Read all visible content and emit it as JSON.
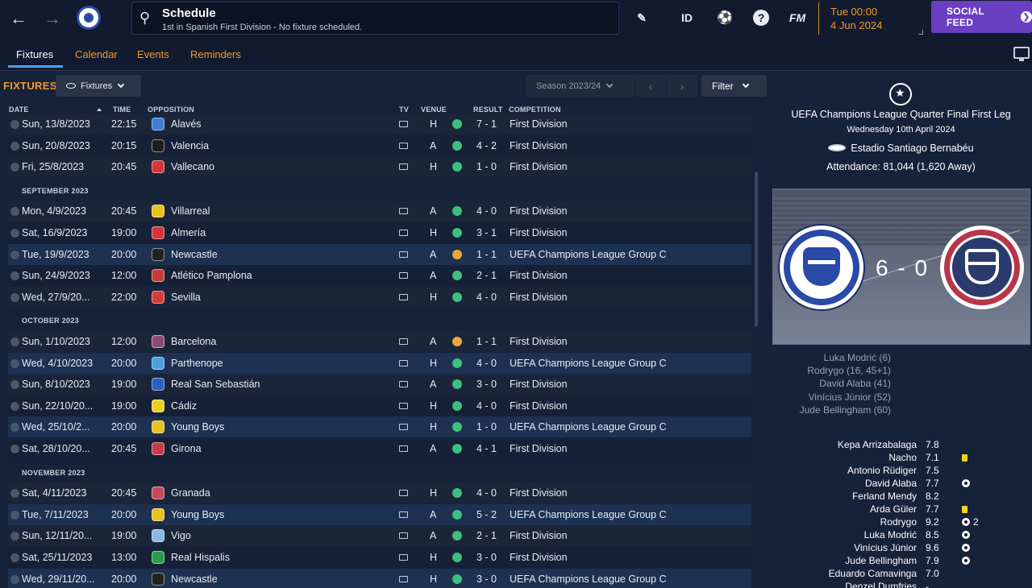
{
  "header": {
    "search_title": "Schedule",
    "search_subtitle": "1st in Spanish First Division - No fixture scheduled.",
    "id_label": "ID",
    "fm_label": "FM",
    "help_label": "?",
    "time": "Tue 00:00",
    "date": "4 Jun 2024",
    "social_feed_label": "SOCIAL FEED",
    "icons": {
      "back": "arrow-left-icon",
      "forward": "arrow-right-icon",
      "search": "search-icon",
      "edit": "pencil-icon",
      "football": "football-icon",
      "help": "help-icon"
    }
  },
  "subnav": {
    "tabs": [
      {
        "label": "Fixtures",
        "active": true
      },
      {
        "label": "Calendar",
        "active": false
      },
      {
        "label": "Events",
        "active": false
      },
      {
        "label": "Reminders",
        "active": false
      }
    ]
  },
  "toolbar": {
    "section_label": "FIXTURES",
    "view_dropdown": "Fixtures",
    "season": "Season 2023/24",
    "filter_label": "Filter",
    "prev_arrow": "‹",
    "next_arrow": "›"
  },
  "table": {
    "columns": {
      "date": "DATE",
      "time": "TIME",
      "opposition": "OPPOSITION",
      "tv": "TV",
      "venue": "VENUE",
      "result": "RESULT",
      "competition": "COMPETITION"
    },
    "sections": [
      "SEPTEMBER 2023",
      "OCTOBER 2023",
      "NOVEMBER 2023"
    ],
    "rows": [
      {
        "date": "Sun, 13/8/2023",
        "time": "22:15",
        "opponent": "Alavés",
        "venue": "H",
        "result": "7 - 1",
        "outcome": "win",
        "competition": "First Division",
        "crest": "#3d7fd6",
        "highlight": false
      },
      {
        "date": "Sun, 20/8/2023",
        "time": "20:15",
        "opponent": "Valencia",
        "venue": "A",
        "result": "4 - 2",
        "outcome": "win",
        "competition": "First Division",
        "crest": "#1c1c1c",
        "highlight": false
      },
      {
        "date": "Fri, 25/8/2023",
        "time": "20:45",
        "opponent": "Vallecano",
        "venue": "H",
        "result": "1 - 0",
        "outcome": "win",
        "competition": "First Division",
        "crest": "#d8343a",
        "highlight": false
      },
      {
        "date": "Mon, 4/9/2023",
        "time": "20:45",
        "opponent": "Villarreal",
        "venue": "A",
        "result": "4 - 0",
        "outcome": "win",
        "competition": "First Division",
        "crest": "#e9c21e",
        "highlight": false
      },
      {
        "date": "Sat, 16/9/2023",
        "time": "19:00",
        "opponent": "Almería",
        "venue": "H",
        "result": "3 - 1",
        "outcome": "win",
        "competition": "First Division",
        "crest": "#d8343a",
        "highlight": false
      },
      {
        "date": "Tue, 19/9/2023",
        "time": "20:00",
        "opponent": "Newcastle",
        "venue": "A",
        "result": "1 - 1",
        "outcome": "draw",
        "competition": "UEFA Champions League Group C",
        "crest": "#222222",
        "highlight": true
      },
      {
        "date": "Sun, 24/9/2023",
        "time": "12:00",
        "opponent": "Atlético Pamplona",
        "venue": "A",
        "result": "2 - 1",
        "outcome": "win",
        "competition": "First Division",
        "crest": "#c63a3a",
        "highlight": false
      },
      {
        "date": "Wed, 27/9/20...",
        "time": "22:00",
        "opponent": "Sevilla",
        "venue": "H",
        "result": "4 - 0",
        "outcome": "win",
        "competition": "First Division",
        "crest": "#d63a3a",
        "highlight": false
      },
      {
        "date": "Sun, 1/10/2023",
        "time": "12:00",
        "opponent": "Barcelona",
        "venue": "A",
        "result": "1 - 1",
        "outcome": "draw",
        "competition": "First Division",
        "crest": "#8a4a78",
        "highlight": false
      },
      {
        "date": "Wed, 4/10/2023",
        "time": "20:00",
        "opponent": "Parthenope",
        "venue": "H",
        "result": "4 - 0",
        "outcome": "win",
        "competition": "UEFA Champions League Group C",
        "crest": "#4aa0e0",
        "highlight": true
      },
      {
        "date": "Sun, 8/10/2023",
        "time": "19:00",
        "opponent": "Real San Sebastián",
        "venue": "A",
        "result": "3 - 0",
        "outcome": "win",
        "competition": "First Division",
        "crest": "#2a5fc2",
        "highlight": false
      },
      {
        "date": "Sun, 22/10/20...",
        "time": "19:00",
        "opponent": "Cádiz",
        "venue": "H",
        "result": "4 - 0",
        "outcome": "win",
        "competition": "First Division",
        "crest": "#e8d020",
        "highlight": false
      },
      {
        "date": "Wed, 25/10/2...",
        "time": "20:00",
        "opponent": "Young Boys",
        "venue": "H",
        "result": "1 - 0",
        "outcome": "win",
        "competition": "UEFA Champions League Group C",
        "crest": "#e8c020",
        "highlight": true
      },
      {
        "date": "Sat, 28/10/20...",
        "time": "20:45",
        "opponent": "Girona",
        "venue": "A",
        "result": "4 - 1",
        "outcome": "win",
        "competition": "First Division",
        "crest": "#c63a4a",
        "highlight": false
      },
      {
        "date": "Sat, 4/11/2023",
        "time": "20:45",
        "opponent": "Granada",
        "venue": "H",
        "result": "4 - 0",
        "outcome": "win",
        "competition": "First Division",
        "crest": "#c6485a",
        "highlight": false
      },
      {
        "date": "Tue, 7/11/2023",
        "time": "20:00",
        "opponent": "Young Boys",
        "venue": "A",
        "result": "5 - 2",
        "outcome": "win",
        "competition": "UEFA Champions League Group C",
        "crest": "#e8c020",
        "highlight": true
      },
      {
        "date": "Sun, 12/11/20...",
        "time": "19:00",
        "opponent": "Vigo",
        "venue": "A",
        "result": "2 - 1",
        "outcome": "win",
        "competition": "First Division",
        "crest": "#8ab8e0",
        "highlight": false
      },
      {
        "date": "Sat, 25/11/2023",
        "time": "13:00",
        "opponent": "Real Hispalis",
        "venue": "H",
        "result": "3 - 0",
        "outcome": "win",
        "competition": "First Division",
        "crest": "#2a9a4a",
        "highlight": false
      },
      {
        "date": "Wed, 29/11/20...",
        "time": "20:00",
        "opponent": "Newcastle",
        "venue": "H",
        "result": "3 - 0",
        "outcome": "win",
        "competition": "UEFA Champions League Group C",
        "crest": "#222222",
        "highlight": true
      }
    ]
  },
  "match": {
    "competition": "UEFA Champions League Quarter Final First Leg",
    "date": "Wednesday 10th April 2024",
    "stadium": "Estadio Santiago Bernabéu",
    "attendance": "Attendance: 81,044 (1,620 Away)",
    "score": "6 - 0",
    "scorers": [
      "Luka Modrić (6)",
      "Rodrygo (16, 45+1)",
      "David Alaba (41)",
      "Vinícius Júnior (52)",
      "Jude Bellingham (60)"
    ],
    "ratings": [
      {
        "name": "Kepa Arrizabalaga",
        "rating": "7.8",
        "icon": "",
        "count": ""
      },
      {
        "name": "Nacho",
        "rating": "7.1",
        "icon": "yellow-card-icon",
        "count": ""
      },
      {
        "name": "Antonio Rüdiger",
        "rating": "7.5",
        "icon": "",
        "count": ""
      },
      {
        "name": "David Alaba",
        "rating": "7.7",
        "icon": "goal-ball-icon",
        "count": ""
      },
      {
        "name": "Ferland Mendy",
        "rating": "8.2",
        "icon": "",
        "count": ""
      },
      {
        "name": "Arda Güler",
        "rating": "7.7",
        "icon": "yellow-card-icon",
        "count": ""
      },
      {
        "name": "Rodrygo",
        "rating": "9.2",
        "icon": "goal-ball-icon",
        "count": "2"
      },
      {
        "name": "Luka Modrić",
        "rating": "8.5",
        "icon": "goal-ball-icon",
        "count": ""
      },
      {
        "name": "Vinícius Júnior",
        "rating": "9.6",
        "icon": "goal-ball-icon",
        "count": ""
      },
      {
        "name": "Jude Bellingham",
        "rating": "7.9",
        "icon": "goal-ball-icon",
        "count": ""
      },
      {
        "name": "Eduardo Camavinga",
        "rating": "7.0",
        "icon": "",
        "count": ""
      },
      {
        "name": "Denzel Dumfries",
        "rating": "-",
        "icon": "",
        "count": ""
      }
    ]
  }
}
